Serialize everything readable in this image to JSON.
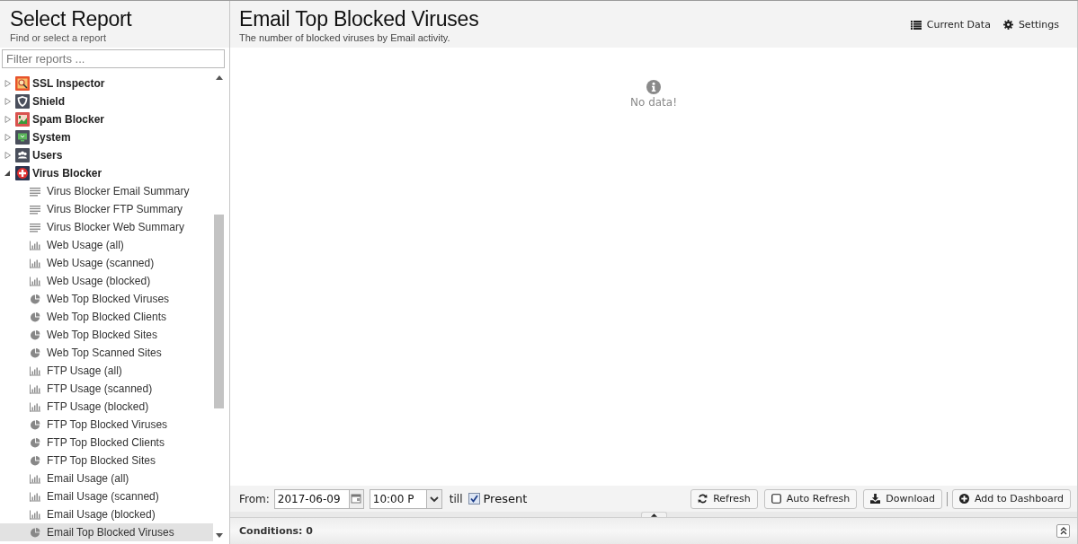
{
  "sidebar": {
    "title": "Select Report",
    "subtitle": "Find or select a report",
    "filter": {
      "placeholder": "Filter reports ..."
    },
    "tree": [
      {
        "label": "SSL Inspector",
        "expanded": false,
        "selected": false
      },
      {
        "label": "Shield",
        "expanded": false,
        "selected": false
      },
      {
        "label": "Spam Blocker",
        "expanded": false,
        "selected": false
      },
      {
        "label": "System",
        "expanded": false,
        "selected": false
      },
      {
        "label": "Users",
        "expanded": false,
        "selected": false
      },
      {
        "label": "Virus Blocker",
        "expanded": true,
        "selected": false,
        "children": [
          {
            "label": "Virus Blocker Email Summary",
            "kind": "summary",
            "selected": false
          },
          {
            "label": "Virus Blocker FTP Summary",
            "kind": "summary",
            "selected": false
          },
          {
            "label": "Virus Blocker Web Summary",
            "kind": "summary",
            "selected": false
          },
          {
            "label": "Web Usage (all)",
            "kind": "bar",
            "selected": false
          },
          {
            "label": "Web Usage (scanned)",
            "kind": "bar",
            "selected": false
          },
          {
            "label": "Web Usage (blocked)",
            "kind": "bar",
            "selected": false
          },
          {
            "label": "Web Top Blocked Viruses",
            "kind": "pie",
            "selected": false
          },
          {
            "label": "Web Top Blocked Clients",
            "kind": "pie",
            "selected": false
          },
          {
            "label": "Web Top Blocked Sites",
            "kind": "pie",
            "selected": false
          },
          {
            "label": "Web Top Scanned Sites",
            "kind": "pie",
            "selected": false
          },
          {
            "label": "FTP Usage (all)",
            "kind": "bar",
            "selected": false
          },
          {
            "label": "FTP Usage (scanned)",
            "kind": "bar",
            "selected": false
          },
          {
            "label": "FTP Usage (blocked)",
            "kind": "bar",
            "selected": false
          },
          {
            "label": "FTP Top Blocked Viruses",
            "kind": "pie",
            "selected": false
          },
          {
            "label": "FTP Top Blocked Clients",
            "kind": "pie",
            "selected": false
          },
          {
            "label": "FTP Top Blocked Sites",
            "kind": "pie",
            "selected": false
          },
          {
            "label": "Email Usage (all)",
            "kind": "bar",
            "selected": false
          },
          {
            "label": "Email Usage (scanned)",
            "kind": "bar",
            "selected": false
          },
          {
            "label": "Email Usage (blocked)",
            "kind": "bar",
            "selected": false
          },
          {
            "label": "Email Top Blocked Viruses",
            "kind": "pie",
            "selected": true
          }
        ]
      }
    ]
  },
  "report": {
    "title": "Email Top Blocked Viruses",
    "description": "The number of blocked viruses by Email activity.",
    "actions": [
      {
        "label": "Current Data",
        "kind": "list"
      },
      {
        "label": "Settings",
        "kind": "settings"
      }
    ],
    "empty_message": "No data!"
  },
  "toolbar": {
    "from_label": "From:",
    "date": "2017-06-09",
    "time": "10:00 P",
    "till_label": "till",
    "present": {
      "label": "Present",
      "checked": true
    },
    "buttons": [
      {
        "label": "Refresh",
        "kind": "refresh"
      },
      {
        "label": "Auto Refresh",
        "kind": "toggle",
        "checked": false
      },
      {
        "label": "Download",
        "kind": "download"
      },
      {
        "label": "Add to Dashboard",
        "kind": "add"
      }
    ]
  },
  "conditions": {
    "label": "Conditions: 0"
  }
}
